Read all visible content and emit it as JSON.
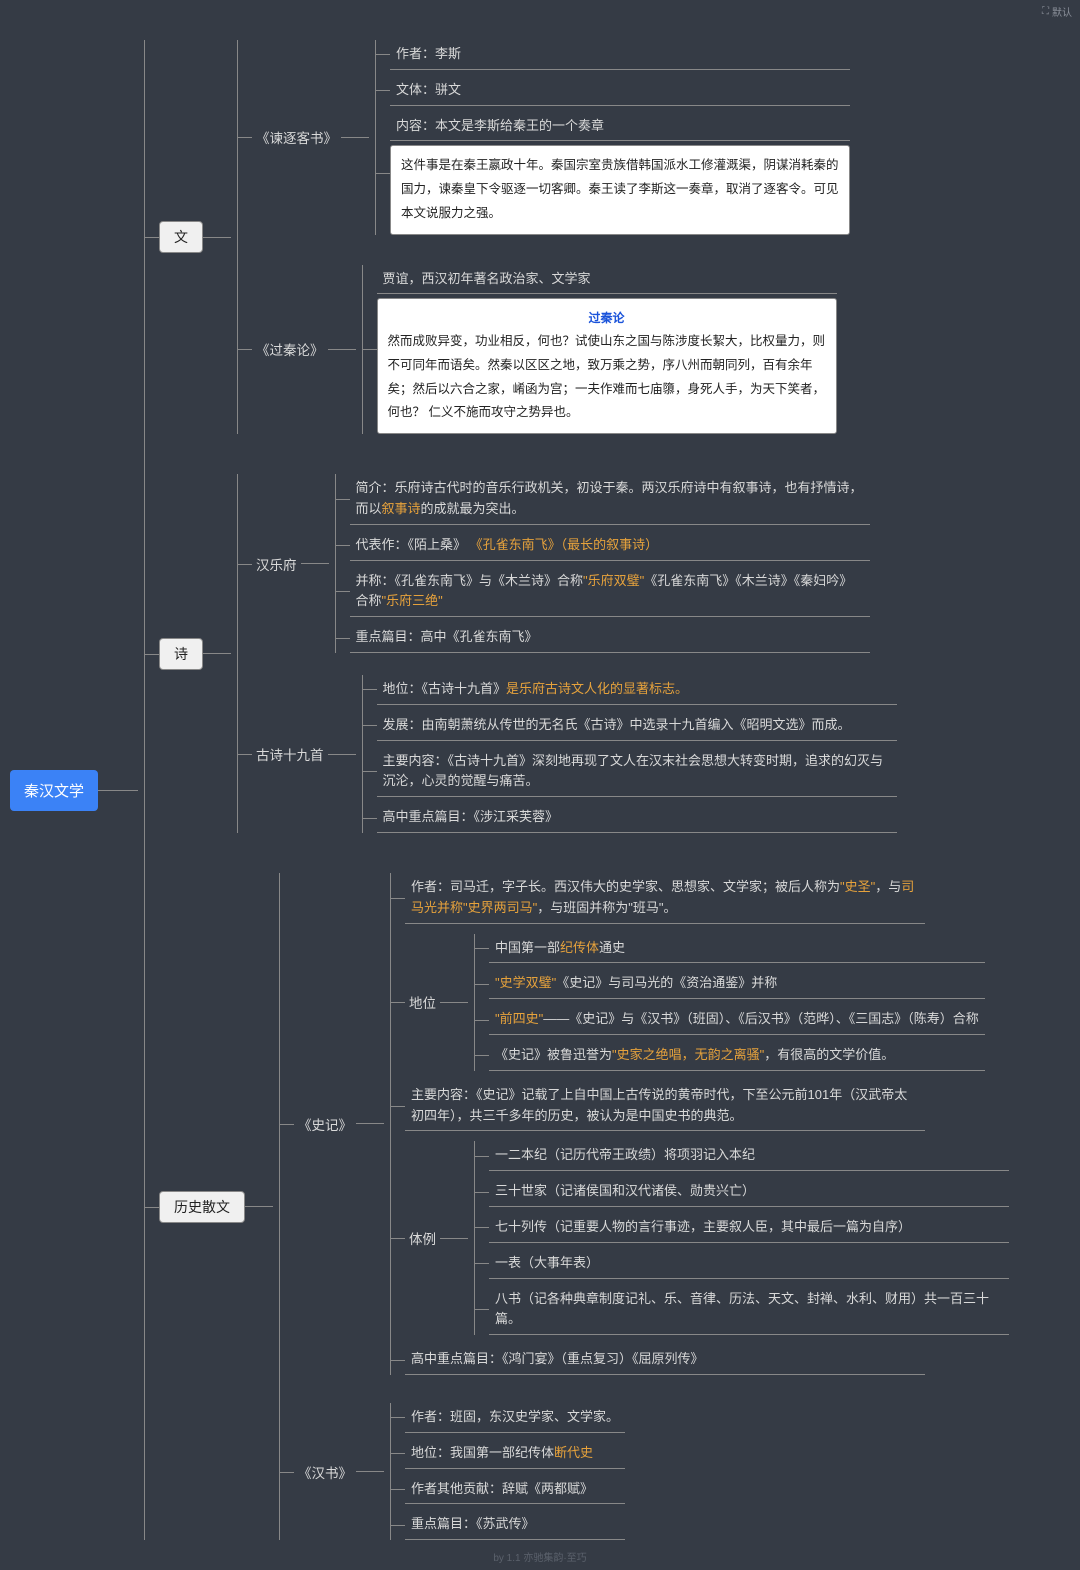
{
  "toolbar": {
    "icon": "⛶",
    "label": "默认"
  },
  "watermark": "by 1.1 亦驰集韵·至巧",
  "root": "秦汉文学",
  "wen": {
    "label": "文",
    "jianzhu": {
      "title": "《谏逐客书》",
      "author": "作者：李斯",
      "style": "文体：骈文",
      "content_label": "内容：本文是李斯给秦王的一个奏章",
      "note": "这件事是在秦王嬴政十年。秦国宗室贵族借韩国派水工修灌溉渠，阴谋消耗秦的国力，谏秦皇下令驱逐一切客卿。秦王读了李斯这一奏章，取消了逐客令。可见本文说服力之强。"
    },
    "guoqin": {
      "title": "《过秦论》",
      "author": "贾谊，西汉初年著名政治家、文学家",
      "note_title": "过秦论",
      "note_body_1": "然而成败异变，功业相反，何也？试使山东之国与陈涉度长絜大，比权量力，则不可同年而语矣。然秦以区区之地，致万乘之势，序八州而朝同列，百有余年矣；然后以六合之家，崤函为宫；一夫作难而七庙隳，身死人手，为天下笑者，何也？",
      "note_body_2": "仁义不施而攻守之势异也。"
    }
  },
  "shi": {
    "label": "诗",
    "yuefu": {
      "title": "汉乐府",
      "intro_a": "简介：乐府诗古代时的音乐行政机关，初设于秦。两汉乐府诗中有叙事诗，也有抒情诗，而以",
      "intro_hl": "叙事诗",
      "intro_b": "的成就最为突出。",
      "rep_a": "代表作：《陌上桑》",
      "rep_hl": "《孔雀东南飞》（最长的叙事诗）",
      "alias_a": "并称：《孔雀东南飞》与《木兰诗》合称",
      "alias_hl1": "\"乐府双璧\"",
      "alias_b": "《孔雀东南飞》《木兰诗》《秦妇吟》合称",
      "alias_hl2": "\"乐府三绝\"",
      "focus": "重点篇目：高中《孔雀东南飞》"
    },
    "gushi": {
      "title": "古诗十九首",
      "pos_a": "地位：《古诗十九首》",
      "pos_hl": "是乐府古诗文人化的显著标志。",
      "dev": "发展：由南朝萧统从传世的无名氏《古诗》中选录十九首编入《昭明文选》而成。",
      "content": "主要内容：《古诗十九首》深刻地再现了文人在汉末社会思想大转变时期，追求的幻灭与沉沦，心灵的觉醒与痛苦。",
      "focus": "高中重点篇目：《涉江采芙蓉》"
    }
  },
  "sanwen": {
    "label": "历史散文",
    "shiji": {
      "title": "《史记》",
      "author_a": "作者：司马迁，字子长。西汉伟大的史学家、思想家、文学家；被后人称为",
      "author_hl1": "\"史圣\"",
      "author_b": "，与",
      "author_hl2": "司马光并称\"史界两司马\"",
      "author_c": "，与班固并称为\"班马\"。",
      "pos_label": "地位",
      "pos1_a": "中国第一部",
      "pos1_hl": "纪传体",
      "pos1_b": "通史",
      "pos2_hl": "\"史学双璧\"",
      "pos2_b": "《史记》与司马光的《资治通鉴》并称",
      "pos3_hl": "\"前四史\"",
      "pos3_b": "——《史记》与《汉书》（班固）、《后汉书》（范晔）、《三国志》（陈寿）合称",
      "pos4_a": "《史记》被鲁迅誉为",
      "pos4_hl": "\"史家之绝唱，无韵之离骚\"",
      "pos4_b": "，有很高的文学价值。",
      "content": "主要内容：《史记》记载了上自中国上古传说的黄帝时代，下至公元前101年（汉武帝太初四年），共三千多年的历史，被认为是中国史书的典范。",
      "tili_label": "体例",
      "tili1": "一二本纪（记历代帝王政绩）将项羽记入本纪",
      "tili2": "三十世家（记诸侯国和汉代诸侯、勋贵兴亡）",
      "tili3": "七十列传（记重要人物的言行事迹，主要叙人臣，其中最后一篇为自序）",
      "tili4": "一表（大事年表）",
      "tili5": "八书（记各种典章制度记礼、乐、音律、历法、天文、封禅、水利、财用）共一百三十篇。",
      "focus": "高中重点篇目：《鸿门宴》（重点复习）《屈原列传》"
    },
    "hanshu": {
      "title": "《汉书》",
      "author": "作者：班固，东汉史学家、文学家。",
      "pos_a": "地位：我国第一部纪传体",
      "pos_hl": "断代史",
      "other": "作者其他贡献：辞赋《两都赋》",
      "focus": "重点篇目：《苏武传》"
    }
  }
}
